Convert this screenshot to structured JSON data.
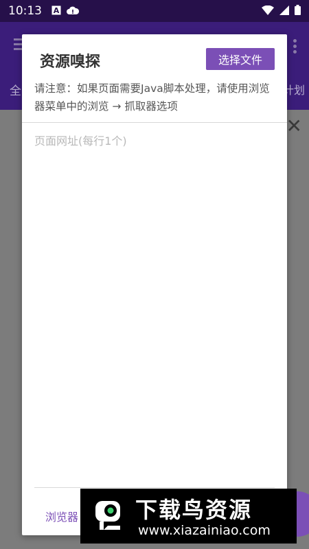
{
  "status_bar": {
    "time": "10:13"
  },
  "app_bar": {
    "tab_left": "全",
    "tab_right": "计划"
  },
  "dialog": {
    "title": "资源嗅探",
    "select_file_label": "选择文件",
    "notice": "请注意：如果页面需要Java脚本处理，请使用浏览器菜单中的浏览 → 抓取器选项",
    "url_input_value": "",
    "url_input_placeholder": "页面网址(每行1个)",
    "browser_button_label": "浏览器"
  },
  "watermark": {
    "title": "下载鸟资源",
    "url": "www.xiazainiao.com"
  },
  "colors": {
    "accent": "#7b4fb6",
    "status_bar": "#26104a",
    "app_bar": "#3b1d7a",
    "scrim": "#7c7c7c"
  }
}
